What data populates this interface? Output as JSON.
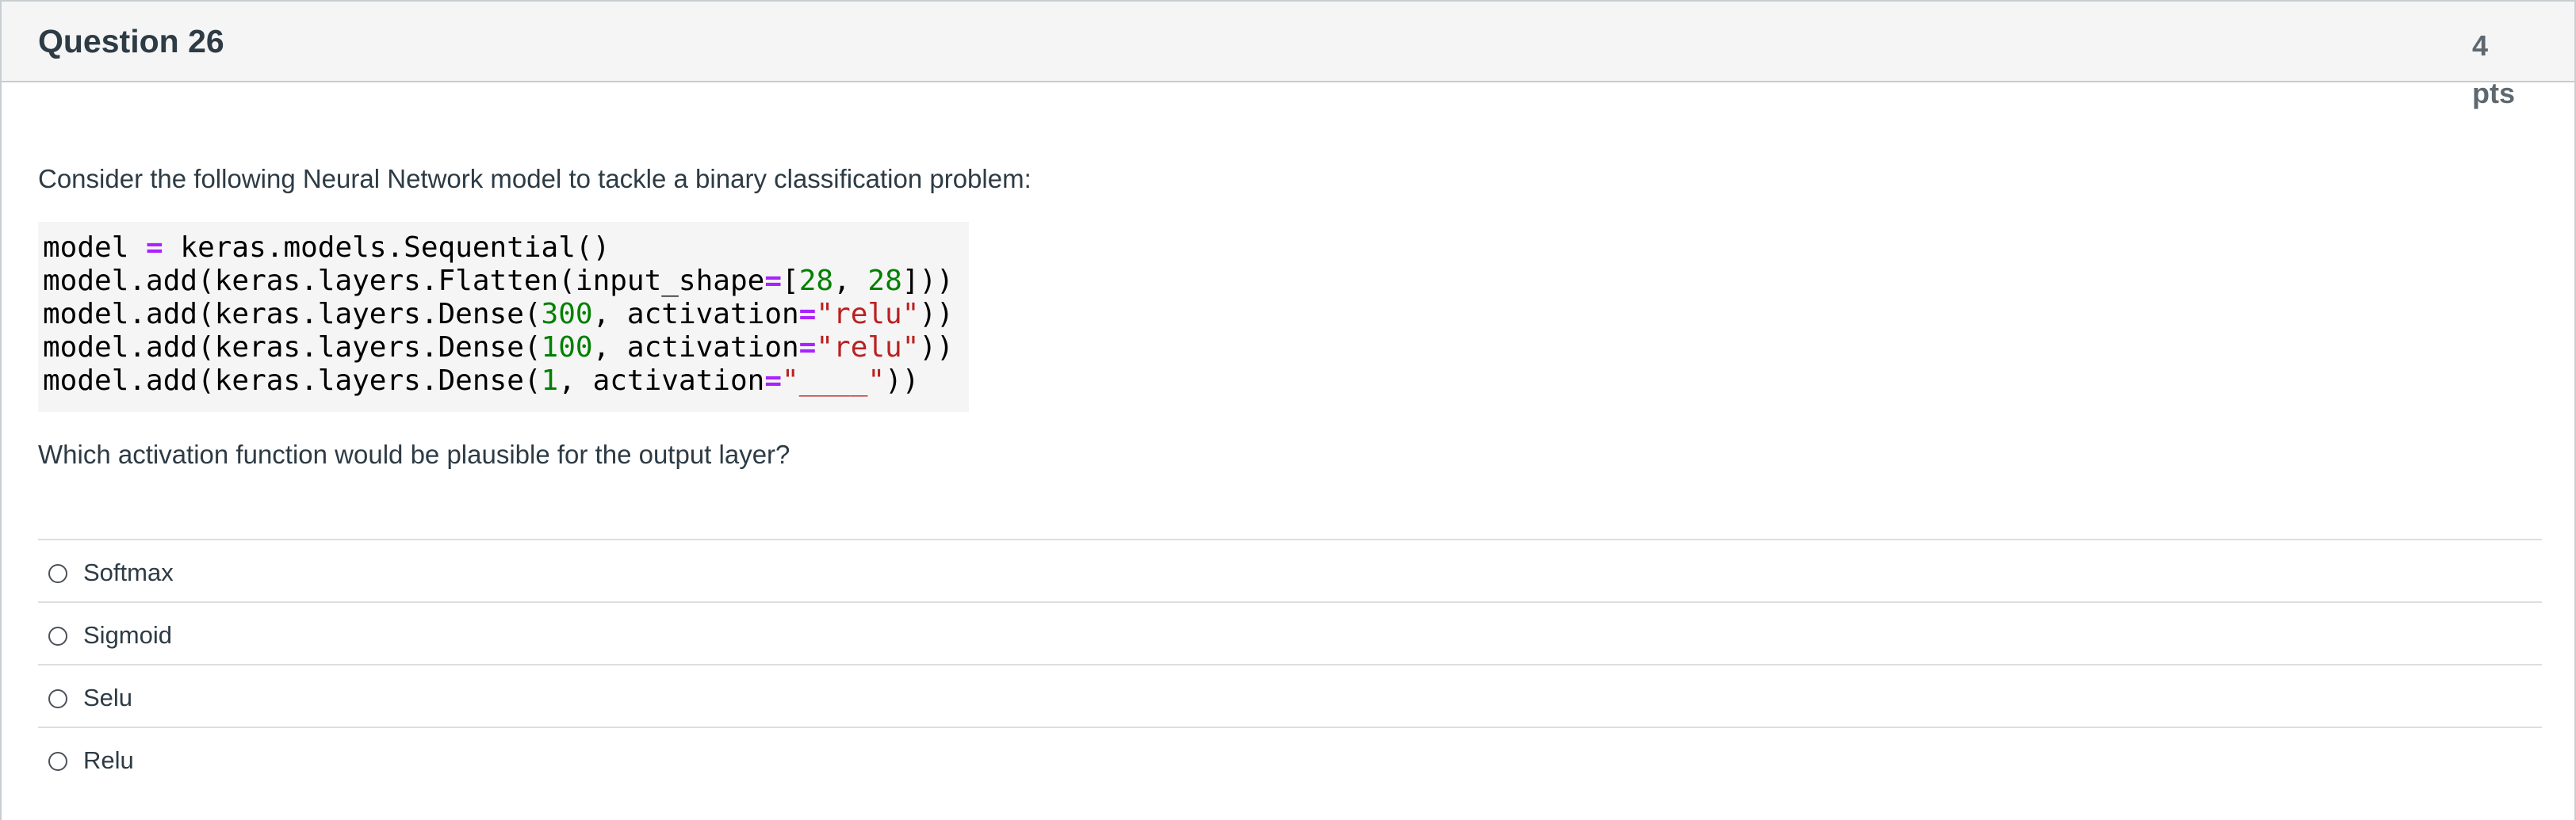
{
  "question": {
    "title": "Question 26",
    "points_value": "4",
    "points_unit": "pts",
    "prompt": "Consider the following Neural Network model to tackle a binary classification problem:",
    "followup": "Which activation function would be plausible for the output layer?"
  },
  "code": {
    "line1": {
      "a": "model ",
      "op": "=",
      "b": " keras.models.Sequential()"
    },
    "line2": {
      "a": "model.add(keras.layers.Flatten(input_shape",
      "op": "=",
      "b": "[",
      "n1": "28",
      "c": ", ",
      "n2": "28",
      "d": "]))"
    },
    "line3": {
      "a": "model.add(keras.layers.Dense(",
      "n": "300",
      "b": ", activation",
      "op": "=",
      "s": "\"relu\"",
      "c": "))"
    },
    "line4": {
      "a": "model.add(keras.layers.Dense(",
      "n": "100",
      "b": ", activation",
      "op": "=",
      "s": "\"relu\"",
      "c": "))"
    },
    "line5": {
      "a": "model.add(keras.layers.Dense(",
      "n": "1",
      "b": ", activation",
      "op": "=",
      "s": "\"____\"",
      "c": "))"
    }
  },
  "answers": [
    {
      "label": "Softmax"
    },
    {
      "label": "Sigmoid"
    },
    {
      "label": "Selu"
    },
    {
      "label": "Relu"
    }
  ]
}
